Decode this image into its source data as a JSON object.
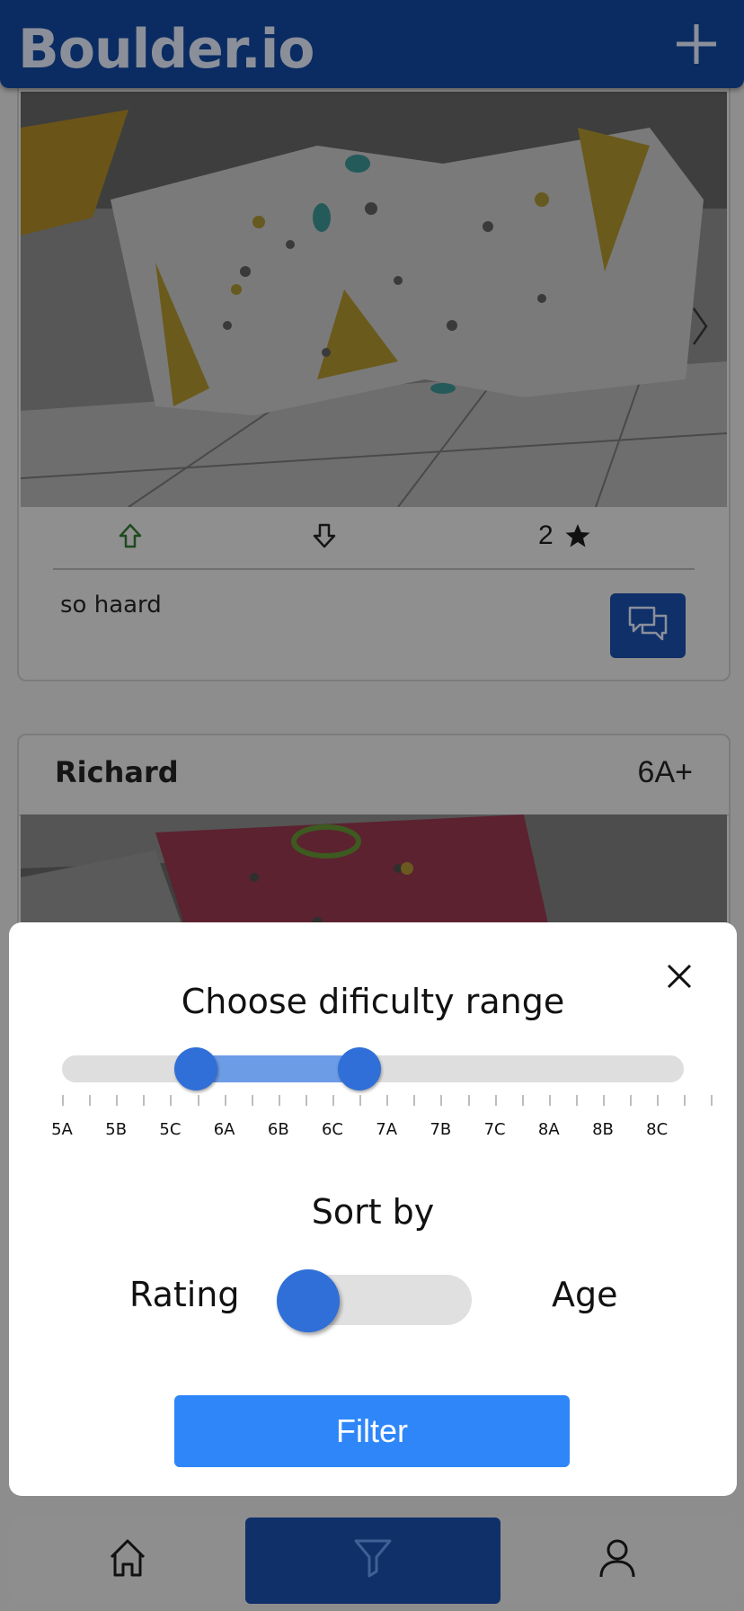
{
  "header": {
    "brand": "Boulder.io",
    "add_icon": "plus-icon"
  },
  "feed": {
    "post1": {
      "upvote_icon": "arrow-up-icon",
      "downvote_icon": "arrow-down-icon",
      "star_count": "2",
      "star_icon": "star-icon",
      "comment": "so haard",
      "comments_icon": "chat-bubbles-icon"
    },
    "post2": {
      "user": "Richard",
      "grade": "6A+"
    }
  },
  "filter_modal": {
    "title": "Choose dificulty range",
    "grades": [
      "5A",
      "5B",
      "5C",
      "6A",
      "6B",
      "6C",
      "7A",
      "7B",
      "7C",
      "8A",
      "8B",
      "8C"
    ],
    "range_low_fraction": 0.215,
    "range_high_fraction": 0.478,
    "sort_title": "Sort by",
    "sort_left": "Rating",
    "sort_right": "Age",
    "sort_value": "Rating",
    "filter_label": "Filter",
    "close_icon": "close-icon"
  },
  "bottom_nav": {
    "home_icon": "home-icon",
    "filter_icon": "filter-icon",
    "profile_icon": "user-icon",
    "active": "filter"
  },
  "colors": {
    "header_bg": "#0b2c63",
    "accent": "#2f6fd7",
    "filter_button": "#2e86f9"
  }
}
